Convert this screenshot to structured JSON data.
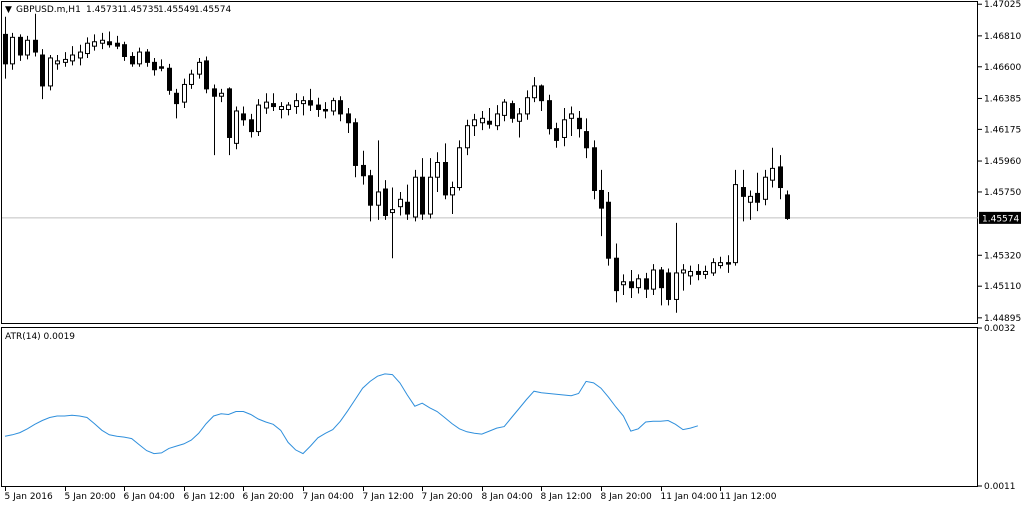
{
  "header": {
    "arrow": "▼",
    "symbol": "GBPUSD.m,H1",
    "open": "1.45731",
    "high": "1.45735",
    "low": "1.45549",
    "close": "1.45574"
  },
  "indicator": {
    "label": "ATR(14) 0.0019"
  },
  "colors": {
    "background": "#ffffff",
    "candle": "#000000",
    "atr_line": "#2f8fdc",
    "price_line": "#c0c0c0",
    "axis": "#000000"
  },
  "chart_data": [
    {
      "type": "candlestick",
      "title": "GBPUSD.m,H1",
      "ylim": [
        1.4486,
        1.4704
      ],
      "y_ticks": [
        "1.47025",
        "1.46810",
        "1.46600",
        "1.46385",
        "1.46175",
        "1.45960",
        "1.45750",
        "1.45320",
        "1.45110",
        "1.44895"
      ],
      "current_price": "1.45574",
      "grid": false,
      "candles": [
        {
          "o": 1.4682,
          "h": 1.4694,
          "l": 1.4652,
          "c": 1.4662
        },
        {
          "o": 1.4662,
          "h": 1.4683,
          "l": 1.4658,
          "c": 1.468
        },
        {
          "o": 1.468,
          "h": 1.4682,
          "l": 1.4664,
          "c": 1.4668
        },
        {
          "o": 1.4668,
          "h": 1.4681,
          "l": 1.4665,
          "c": 1.4678
        },
        {
          "o": 1.4678,
          "h": 1.4696,
          "l": 1.4667,
          "c": 1.467
        },
        {
          "o": 1.4668,
          "h": 1.4672,
          "l": 1.4638,
          "c": 1.4647
        },
        {
          "o": 1.4647,
          "h": 1.4668,
          "l": 1.4644,
          "c": 1.4666
        },
        {
          "o": 1.4662,
          "h": 1.4668,
          "l": 1.4658,
          "c": 1.4664
        },
        {
          "o": 1.4663,
          "h": 1.467,
          "l": 1.466,
          "c": 1.4665
        },
        {
          "o": 1.4664,
          "h": 1.4674,
          "l": 1.4661,
          "c": 1.4668
        },
        {
          "o": 1.4666,
          "h": 1.4675,
          "l": 1.4661,
          "c": 1.467
        },
        {
          "o": 1.4669,
          "h": 1.468,
          "l": 1.4666,
          "c": 1.4676
        },
        {
          "o": 1.4674,
          "h": 1.4682,
          "l": 1.4671,
          "c": 1.4677
        },
        {
          "o": 1.4676,
          "h": 1.4683,
          "l": 1.4672,
          "c": 1.4678
        },
        {
          "o": 1.4677,
          "h": 1.4684,
          "l": 1.4673,
          "c": 1.4675
        },
        {
          "o": 1.4676,
          "h": 1.4681,
          "l": 1.4672,
          "c": 1.4674
        },
        {
          "o": 1.4675,
          "h": 1.4677,
          "l": 1.4664,
          "c": 1.4667
        },
        {
          "o": 1.4667,
          "h": 1.467,
          "l": 1.466,
          "c": 1.4662
        },
        {
          "o": 1.4662,
          "h": 1.4673,
          "l": 1.466,
          "c": 1.467
        },
        {
          "o": 1.467,
          "h": 1.4672,
          "l": 1.466,
          "c": 1.4663
        },
        {
          "o": 1.4663,
          "h": 1.4666,
          "l": 1.4654,
          "c": 1.4658
        },
        {
          "o": 1.466,
          "h": 1.4665,
          "l": 1.4657,
          "c": 1.4659
        },
        {
          "o": 1.4659,
          "h": 1.4662,
          "l": 1.4641,
          "c": 1.4644
        },
        {
          "o": 1.4642,
          "h": 1.4645,
          "l": 1.4625,
          "c": 1.4635
        },
        {
          "o": 1.4636,
          "h": 1.4652,
          "l": 1.4632,
          "c": 1.4648
        },
        {
          "o": 1.4648,
          "h": 1.4658,
          "l": 1.4645,
          "c": 1.4655
        },
        {
          "o": 1.4655,
          "h": 1.4666,
          "l": 1.4652,
          "c": 1.4663
        },
        {
          "o": 1.4664,
          "h": 1.4667,
          "l": 1.4642,
          "c": 1.4645
        },
        {
          "o": 1.4645,
          "h": 1.4648,
          "l": 1.46,
          "c": 1.464
        },
        {
          "o": 1.464,
          "h": 1.4645,
          "l": 1.4636,
          "c": 1.4642
        },
        {
          "o": 1.4645,
          "h": 1.4646,
          "l": 1.46,
          "c": 1.4612
        },
        {
          "o": 1.4608,
          "h": 1.4633,
          "l": 1.4604,
          "c": 1.463
        },
        {
          "o": 1.4628,
          "h": 1.4633,
          "l": 1.462,
          "c": 1.4624
        },
        {
          "o": 1.4624,
          "h": 1.4628,
          "l": 1.4612,
          "c": 1.4616
        },
        {
          "o": 1.4616,
          "h": 1.4638,
          "l": 1.4613,
          "c": 1.4634
        },
        {
          "o": 1.4632,
          "h": 1.4642,
          "l": 1.4628,
          "c": 1.4636
        },
        {
          "o": 1.4635,
          "h": 1.4642,
          "l": 1.463,
          "c": 1.4633
        },
        {
          "o": 1.4631,
          "h": 1.4636,
          "l": 1.4625,
          "c": 1.4633
        },
        {
          "o": 1.4631,
          "h": 1.4636,
          "l": 1.4627,
          "c": 1.4634
        },
        {
          "o": 1.4633,
          "h": 1.4642,
          "l": 1.4628,
          "c": 1.4637
        },
        {
          "o": 1.4635,
          "h": 1.464,
          "l": 1.4627,
          "c": 1.4637
        },
        {
          "o": 1.4637,
          "h": 1.4645,
          "l": 1.463,
          "c": 1.4634
        },
        {
          "o": 1.4634,
          "h": 1.4639,
          "l": 1.4626,
          "c": 1.4631
        },
        {
          "o": 1.4631,
          "h": 1.4636,
          "l": 1.4625,
          "c": 1.463
        },
        {
          "o": 1.463,
          "h": 1.4639,
          "l": 1.4627,
          "c": 1.4637
        },
        {
          "o": 1.4637,
          "h": 1.464,
          "l": 1.4623,
          "c": 1.4628
        },
        {
          "o": 1.4628,
          "h": 1.4632,
          "l": 1.4615,
          "c": 1.4622
        },
        {
          "o": 1.4622,
          "h": 1.4625,
          "l": 1.4585,
          "c": 1.4593
        },
        {
          "o": 1.4593,
          "h": 1.4603,
          "l": 1.458,
          "c": 1.4586
        },
        {
          "o": 1.4586,
          "h": 1.459,
          "l": 1.4555,
          "c": 1.4566
        },
        {
          "o": 1.4566,
          "h": 1.461,
          "l": 1.4556,
          "c": 1.4575
        },
        {
          "o": 1.4577,
          "h": 1.4583,
          "l": 1.4556,
          "c": 1.4559
        },
        {
          "o": 1.4561,
          "h": 1.4578,
          "l": 1.453,
          "c": 1.4563
        },
        {
          "o": 1.4565,
          "h": 1.4575,
          "l": 1.4559,
          "c": 1.457
        },
        {
          "o": 1.4568,
          "h": 1.458,
          "l": 1.4556,
          "c": 1.456
        },
        {
          "o": 1.4558,
          "h": 1.459,
          "l": 1.4555,
          "c": 1.4585
        },
        {
          "o": 1.4585,
          "h": 1.4598,
          "l": 1.4556,
          "c": 1.456
        },
        {
          "o": 1.456,
          "h": 1.4598,
          "l": 1.4557,
          "c": 1.4585
        },
        {
          "o": 1.4585,
          "h": 1.4602,
          "l": 1.4575,
          "c": 1.4595
        },
        {
          "o": 1.4595,
          "h": 1.4608,
          "l": 1.457,
          "c": 1.4573
        },
        {
          "o": 1.4573,
          "h": 1.4582,
          "l": 1.456,
          "c": 1.4578
        },
        {
          "o": 1.4578,
          "h": 1.461,
          "l": 1.4576,
          "c": 1.4605
        },
        {
          "o": 1.4605,
          "h": 1.4624,
          "l": 1.46,
          "c": 1.462
        },
        {
          "o": 1.462,
          "h": 1.4628,
          "l": 1.4613,
          "c": 1.4624
        },
        {
          "o": 1.4622,
          "h": 1.463,
          "l": 1.4617,
          "c": 1.4625
        },
        {
          "o": 1.4623,
          "h": 1.4632,
          "l": 1.4618,
          "c": 1.4621
        },
        {
          "o": 1.462,
          "h": 1.4634,
          "l": 1.4617,
          "c": 1.4628
        },
        {
          "o": 1.4627,
          "h": 1.4638,
          "l": 1.4623,
          "c": 1.4636
        },
        {
          "o": 1.4635,
          "h": 1.4637,
          "l": 1.4622,
          "c": 1.4625
        },
        {
          "o": 1.4623,
          "h": 1.4632,
          "l": 1.4612,
          "c": 1.4628
        },
        {
          "o": 1.4628,
          "h": 1.4644,
          "l": 1.4624,
          "c": 1.4639
        },
        {
          "o": 1.4639,
          "h": 1.4653,
          "l": 1.4636,
          "c": 1.4647
        },
        {
          "o": 1.4647,
          "h": 1.4648,
          "l": 1.463,
          "c": 1.4637
        },
        {
          "o": 1.4637,
          "h": 1.4641,
          "l": 1.4614,
          "c": 1.4618
        },
        {
          "o": 1.4618,
          "h": 1.4622,
          "l": 1.4605,
          "c": 1.461
        },
        {
          "o": 1.4612,
          "h": 1.4632,
          "l": 1.4606,
          "c": 1.4624
        },
        {
          "o": 1.4625,
          "h": 1.4633,
          "l": 1.4613,
          "c": 1.4628
        },
        {
          "o": 1.4625,
          "h": 1.463,
          "l": 1.4612,
          "c": 1.4618
        },
        {
          "o": 1.4616,
          "h": 1.4625,
          "l": 1.4598,
          "c": 1.4605
        },
        {
          "o": 1.4605,
          "h": 1.461,
          "l": 1.457,
          "c": 1.4576
        },
        {
          "o": 1.4576,
          "h": 1.459,
          "l": 1.4545,
          "c": 1.4564
        },
        {
          "o": 1.4568,
          "h": 1.4575,
          "l": 1.4525,
          "c": 1.453
        },
        {
          "o": 1.453,
          "h": 1.454,
          "l": 1.45,
          "c": 1.4508
        },
        {
          "o": 1.4512,
          "h": 1.4519,
          "l": 1.4505,
          "c": 1.4514
        },
        {
          "o": 1.4514,
          "h": 1.4522,
          "l": 1.4503,
          "c": 1.451
        },
        {
          "o": 1.451,
          "h": 1.4519,
          "l": 1.4506,
          "c": 1.4516
        },
        {
          "o": 1.4516,
          "h": 1.452,
          "l": 1.4503,
          "c": 1.4509
        },
        {
          "o": 1.4509,
          "h": 1.4526,
          "l": 1.4505,
          "c": 1.4522
        },
        {
          "o": 1.4522,
          "h": 1.4524,
          "l": 1.4498,
          "c": 1.451
        },
        {
          "o": 1.452,
          "h": 1.4523,
          "l": 1.4498,
          "c": 1.4502
        },
        {
          "o": 1.4502,
          "h": 1.4554,
          "l": 1.4493,
          "c": 1.452
        },
        {
          "o": 1.452,
          "h": 1.4526,
          "l": 1.4508,
          "c": 1.4522
        },
        {
          "o": 1.4518,
          "h": 1.4525,
          "l": 1.4512,
          "c": 1.4521
        },
        {
          "o": 1.4521,
          "h": 1.4526,
          "l": 1.4515,
          "c": 1.4519
        },
        {
          "o": 1.4519,
          "h": 1.4525,
          "l": 1.4516,
          "c": 1.4521
        },
        {
          "o": 1.452,
          "h": 1.453,
          "l": 1.4518,
          "c": 1.4527
        },
        {
          "o": 1.4525,
          "h": 1.4531,
          "l": 1.4523,
          "c": 1.4527
        },
        {
          "o": 1.4527,
          "h": 1.4532,
          "l": 1.452,
          "c": 1.4526
        },
        {
          "o": 1.4527,
          "h": 1.459,
          "l": 1.4525,
          "c": 1.458
        },
        {
          "o": 1.4578,
          "h": 1.459,
          "l": 1.4555,
          "c": 1.4572
        },
        {
          "o": 1.4568,
          "h": 1.4576,
          "l": 1.4556,
          "c": 1.4572
        },
        {
          "o": 1.4574,
          "h": 1.4588,
          "l": 1.4562,
          "c": 1.4568
        },
        {
          "o": 1.457,
          "h": 1.459,
          "l": 1.4566,
          "c": 1.4585
        },
        {
          "o": 1.4583,
          "h": 1.4605,
          "l": 1.4578,
          "c": 1.4591
        },
        {
          "o": 1.4592,
          "h": 1.46,
          "l": 1.457,
          "c": 1.4578
        },
        {
          "o": 1.4573,
          "h": 1.4576,
          "l": 1.4556,
          "c": 1.4557
        }
      ],
      "x_labels": [
        "5 Jan 2016",
        "5 Jan 20:00",
        "6 Jan 04:00",
        "6 Jan 12:00",
        "6 Jan 20:00",
        "7 Jan 04:00",
        "7 Jan 12:00",
        "7 Jan 20:00",
        "8 Jan 04:00",
        "8 Jan 12:00",
        "8 Jan 20:00",
        "11 Jan 04:00",
        "11 Jan 12:00"
      ]
    },
    {
      "type": "line",
      "title": "ATR(14) 0.0019",
      "ylim": [
        0.0011,
        0.0032
      ],
      "y_ticks": [
        "0.0032",
        "0.0011"
      ],
      "series": [
        {
          "name": "ATR(14)",
          "values": [
            0.00176,
            0.00178,
            0.00181,
            0.00186,
            0.00192,
            0.00197,
            0.00201,
            0.00203,
            0.00203,
            0.00204,
            0.00203,
            0.00201,
            0.00193,
            0.00184,
            0.00178,
            0.00176,
            0.00175,
            0.00173,
            0.00165,
            0.00157,
            0.00153,
            0.00154,
            0.0016,
            0.00163,
            0.00166,
            0.00171,
            0.0018,
            0.00193,
            0.00203,
            0.00206,
            0.00205,
            0.00209,
            0.00209,
            0.00205,
            0.00199,
            0.00195,
            0.00192,
            0.00184,
            0.00168,
            0.00158,
            0.00153,
            0.00163,
            0.00174,
            0.0018,
            0.00185,
            0.00196,
            0.0021,
            0.00225,
            0.0024,
            0.00249,
            0.00256,
            0.00259,
            0.00258,
            0.00247,
            0.00231,
            0.00216,
            0.0022,
            0.00214,
            0.00209,
            0.00201,
            0.00193,
            0.00186,
            0.00182,
            0.0018,
            0.00179,
            0.00183,
            0.00187,
            0.00189,
            0.00201,
            0.00213,
            0.00225,
            0.00236,
            0.00234,
            0.00233,
            0.00232,
            0.00231,
            0.0023,
            0.00233,
            0.00249,
            0.00247,
            0.0024,
            0.00228,
            0.00215,
            0.00203,
            0.00183,
            0.00186,
            0.00195,
            0.00196,
            0.00196,
            0.00197,
            0.00192,
            0.00185,
            0.00187,
            0.0019
          ]
        }
      ]
    }
  ]
}
